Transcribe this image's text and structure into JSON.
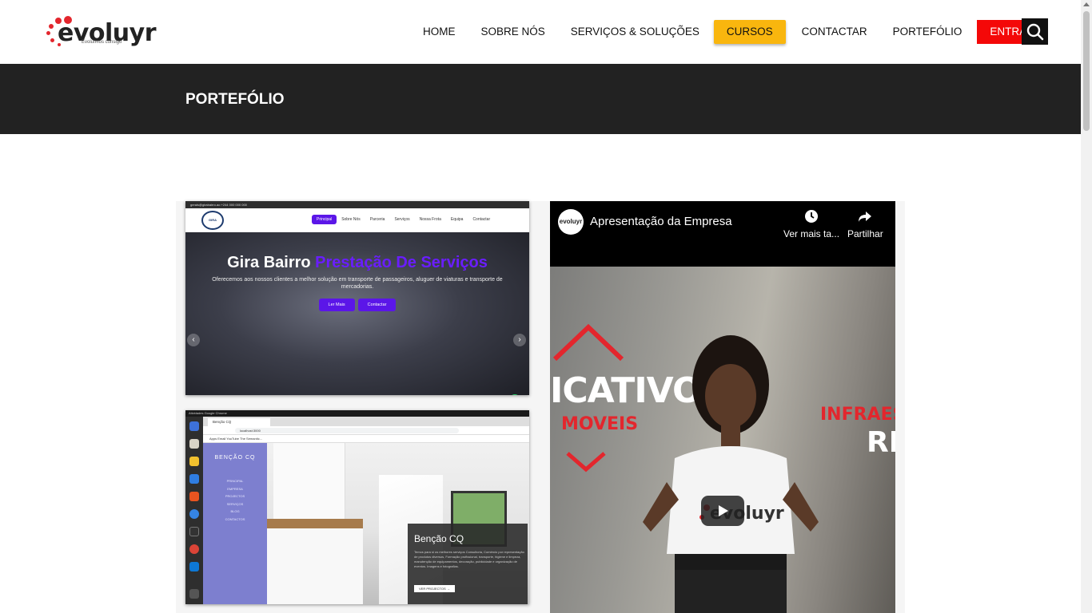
{
  "brand": {
    "name": "evoluyr",
    "tagline": "Evoluímos consigo",
    "accent": "#e3262d"
  },
  "nav": {
    "items": [
      {
        "label": "HOME"
      },
      {
        "label": "SOBRE NÓS"
      },
      {
        "label": "SERVIÇOS & SOLUÇÕES"
      },
      {
        "label": "CURSOS"
      },
      {
        "label": "CONTACTAR"
      },
      {
        "label": "PORTEFÓLIO"
      }
    ],
    "login_label": "ENTRAR",
    "cursos_color": "#f9b60e",
    "login_color": "#f40808"
  },
  "banner": {
    "title": "PORTEFÓLIO"
  },
  "portfolio": {
    "items": [
      {
        "type": "screenshot",
        "topbar": "gerais@girabairro.ao     +244 000 000 000",
        "logo_text": "GIRA BAIRRO",
        "menu": [
          "Principal",
          "Sobre Nós",
          "Parceria",
          "Serviços",
          "Nossa Frota",
          "Equipa",
          "Contactar"
        ],
        "headline_white": "Gira Bairro",
        "headline_purple": "Prestação De Serviços",
        "subtitle": "Oferecemos aos nossos clientes a melhor solução em transporte de passageiros, aluguer de viaturas e transporte de mercadorias.",
        "buttons": [
          "Ler Mais",
          "Contactar"
        ]
      },
      {
        "type": "screenshot",
        "os_topbar": "Atividades   Google Chrome",
        "tab_title": "Benção CQ",
        "url": "localhost:3000",
        "bookmarks": "Apps   Email   YouTube   The Semantic...",
        "site_title": "BENÇÃO CQ",
        "side_menu": [
          "PRINCIPAL",
          "EMPRESA",
          "PROJECTOS",
          "SERVIÇOS",
          "BLOG",
          "CONTACTOS"
        ],
        "card_title": "Benção CQ",
        "card_text": "Temos para si os melhores serviços Consultoria, Comércio por representação de produtos diversos, Formação profissional, transporte, higiene e limpeza, manutenção de equipamentos, decoração, publicidade e organização de eventos. Imagens e fotografias.",
        "card_button": "VER PROJECTOS →"
      }
    ],
    "video": {
      "channel": "evoluyr",
      "title": "Apresentação da Empresa",
      "watch_later": "Ver mais ta...",
      "share": "Partilhar",
      "overlay_words": [
        "ICATIVOS",
        "MOVEIS",
        "INFRAES",
        "RE"
      ]
    }
  }
}
